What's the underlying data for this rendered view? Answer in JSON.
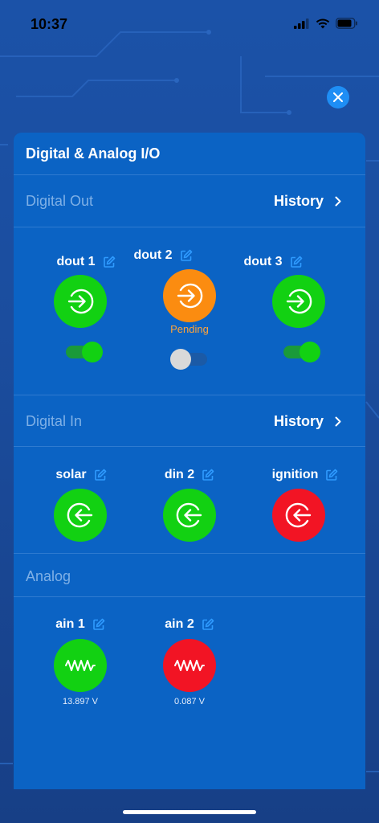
{
  "status_bar": {
    "time": "10:37"
  },
  "panel": {
    "title": "Digital & Analog I/O"
  },
  "digital_out": {
    "label": "Digital Out",
    "history_label": "History",
    "items": [
      {
        "name": "dout 1",
        "state_color": "#12d112",
        "toggle_on": true,
        "status": ""
      },
      {
        "name": "dout 2",
        "state_color": "#fb8c10",
        "toggle_on": false,
        "status": "Pending"
      },
      {
        "name": "dout 3",
        "state_color": "#12d112",
        "toggle_on": true,
        "status": ""
      }
    ]
  },
  "digital_in": {
    "label": "Digital In",
    "history_label": "History",
    "items": [
      {
        "name": "solar",
        "state_color": "#12d112"
      },
      {
        "name": "din 2",
        "state_color": "#12d112"
      },
      {
        "name": "ignition",
        "state_color": "#f21424"
      }
    ]
  },
  "analog": {
    "label": "Analog",
    "items": [
      {
        "name": "ain 1",
        "value": "13.897 V",
        "state_color": "#12d112"
      },
      {
        "name": "ain 2",
        "value": "0.087 V",
        "state_color": "#f21424"
      }
    ]
  },
  "icons": {
    "close": "close-icon",
    "edit": "edit-icon",
    "output": "arrow-right-circle-icon",
    "input": "arrow-left-circle-icon",
    "analog": "waveform-icon",
    "chevron": "chevron-right-icon"
  },
  "colors": {
    "panel_bg": "#0b63c4",
    "accent": "#1e8ef5",
    "on_green": "#12d112",
    "pending_orange": "#fb8c10",
    "off_red": "#f21424",
    "section_label": "#7fb0e6"
  }
}
